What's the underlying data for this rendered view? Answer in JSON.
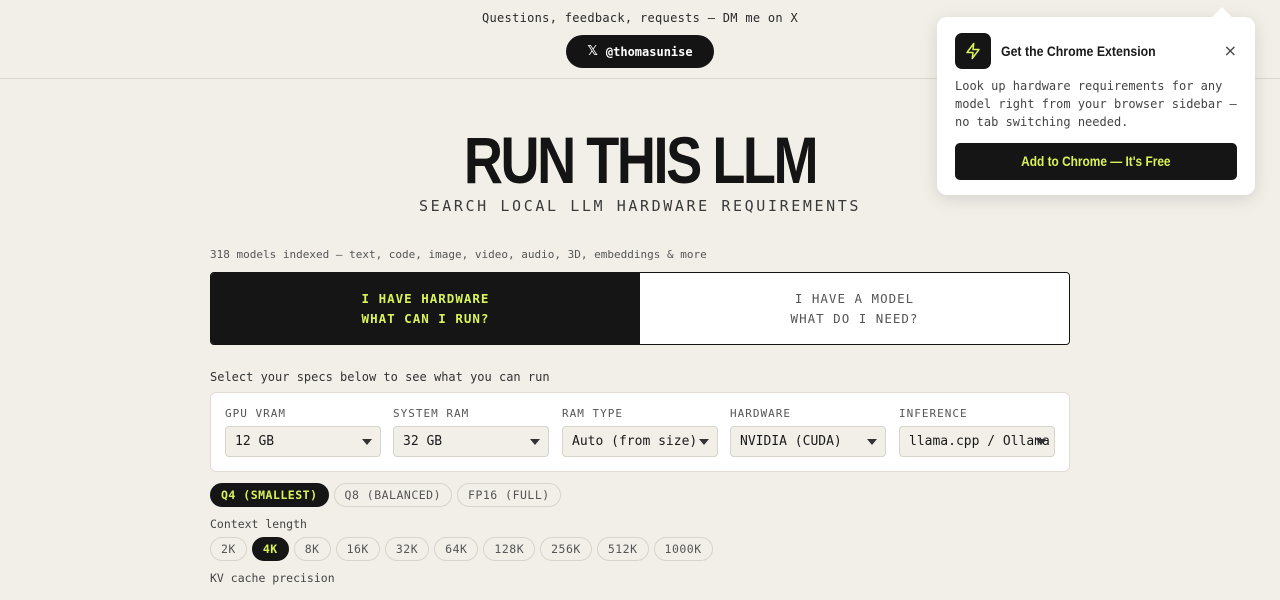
{
  "topbar": {
    "message": "Questions, feedback, requests — DM me on X",
    "x_icon": "x-logo-icon",
    "x_handle": "@thomasunise"
  },
  "hero": {
    "title": "RUN THIS LLM",
    "subtitle": "SEARCH LOCAL LLM HARDWARE REQUIREMENTS"
  },
  "indexed_text": "318 models indexed — text, code, image, video, audio, 3D, embeddings & more",
  "mode_toggle": {
    "hardware": {
      "line1": "I HAVE HARDWARE",
      "line2": "WHAT CAN I RUN?",
      "active": true
    },
    "model": {
      "line1": "I HAVE A MODEL",
      "line2": "WHAT DO I NEED?",
      "active": false
    }
  },
  "specs_intro": "Select your specs below to see what you can run",
  "specs": [
    {
      "label": "GPU VRAM",
      "value": "12 GB"
    },
    {
      "label": "SYSTEM RAM",
      "value": "32 GB"
    },
    {
      "label": "RAM TYPE",
      "value": "Auto (from size)"
    },
    {
      "label": "HARDWARE",
      "value": "NVIDIA (CUDA)"
    },
    {
      "label": "INFERENCE",
      "value": "llama.cpp / Ollama"
    }
  ],
  "quantization": {
    "options": [
      "Q4 (SMALLEST)",
      "Q8 (BALANCED)",
      "FP16 (FULL)"
    ],
    "selected": "Q4 (SMALLEST)"
  },
  "context_length": {
    "label": "Context length",
    "options": [
      "2K",
      "4K",
      "8K",
      "16K",
      "32K",
      "64K",
      "128K",
      "256K",
      "512K",
      "1000K"
    ],
    "selected": "4K"
  },
  "kv_cache": {
    "label": "KV cache precision"
  },
  "popup": {
    "icon": "lightning-bolt-icon",
    "title": "Get the Chrome Extension",
    "close": "×",
    "body": "Look up hardware requirements for any model right from your browser sidebar — no tab switching needed.",
    "cta": "Add to Chrome — It's Free"
  },
  "colors": {
    "background": "#f2efe9",
    "dark": "#151515",
    "accent": "#d8f25a"
  }
}
